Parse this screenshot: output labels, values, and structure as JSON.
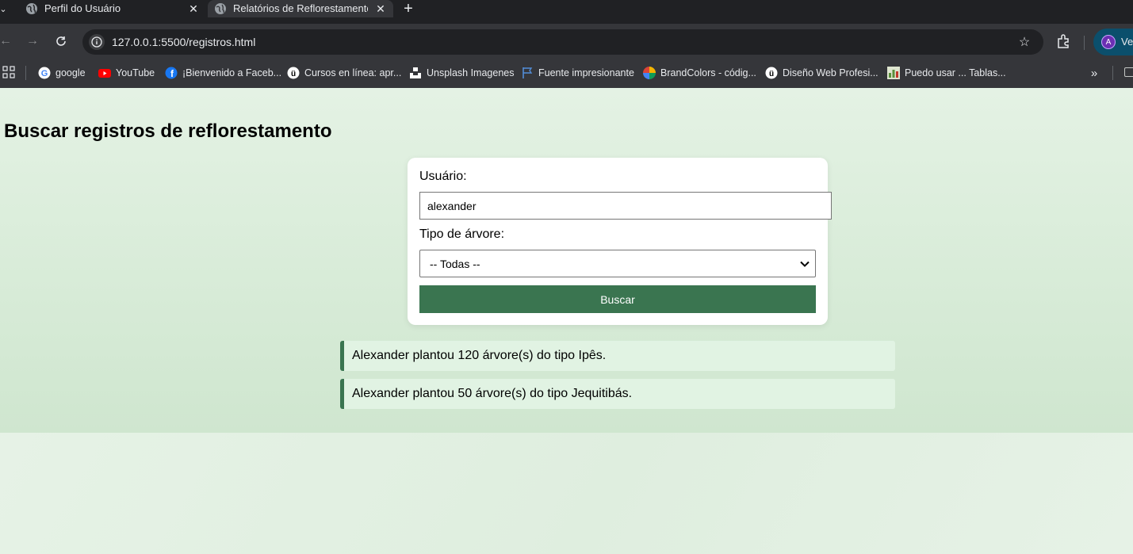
{
  "browser": {
    "tabs": [
      {
        "title": "Perfil do Usuário",
        "active": false
      },
      {
        "title": "Relatórios de Reflorestamento",
        "active": true
      }
    ],
    "url": "127.0.0.1:5500/registros.html",
    "profile": {
      "initial": "A",
      "label": "Ve"
    },
    "bookmarks": [
      {
        "label": "google",
        "icon": "google-icon"
      },
      {
        "label": "YouTube",
        "icon": "youtube-icon"
      },
      {
        "label": "¡Bienvenido a Faceb...",
        "icon": "facebook-icon"
      },
      {
        "label": "Cursos en línea: apr...",
        "icon": "udemy-icon"
      },
      {
        "label": "Unsplash Imagenes",
        "icon": "unsplash-icon"
      },
      {
        "label": "Fuente impresionante",
        "icon": "flag-icon"
      },
      {
        "label": "BrandColors - códig...",
        "icon": "brandcolors-icon"
      },
      {
        "label": "Diseño Web Profesi...",
        "icon": "udemy-icon"
      },
      {
        "label": "Puedo usar ... Tablas...",
        "icon": "caniuse-icon"
      }
    ]
  },
  "page": {
    "title": "Buscar registros de reflorestamento",
    "form": {
      "user_label": "Usuário:",
      "user_value": "alexander",
      "tree_label": "Tipo de árvore:",
      "tree_selected": "-- Todas --",
      "search_button": "Buscar"
    },
    "results": [
      "Alexander plantou 120 árvore(s) do tipo Ipês.",
      "Alexander plantou 50 árvore(s) do tipo Jequitibás."
    ]
  },
  "colors": {
    "accent_green": "#3a7550",
    "result_bg": "#e1f3e3",
    "page_bg": "#e3f0e3"
  }
}
